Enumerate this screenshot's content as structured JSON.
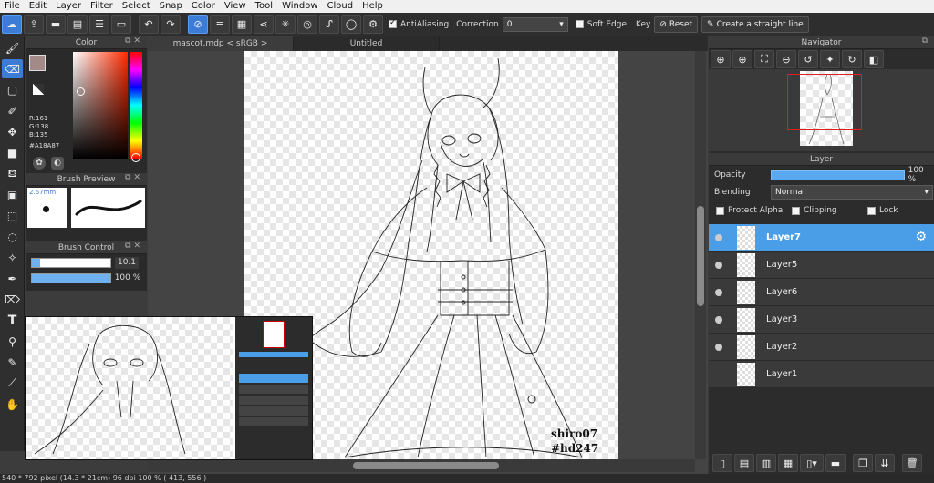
{
  "menu": [
    "File",
    "Edit",
    "Layer",
    "Filter",
    "Select",
    "Snap",
    "Color",
    "View",
    "Tool",
    "Window",
    "Cloud",
    "Help"
  ],
  "toolbar": {
    "antialiasing_label": "AntiAliasing",
    "correction_label": "Correction",
    "correction_value": "0",
    "soft_edge_label": "Soft Edge",
    "key_label": "Key",
    "reset_label": "Reset",
    "straight_line_label": "Create a straight line"
  },
  "color_panel": {
    "title": "Color",
    "r": "R:161",
    "g": "G:138",
    "b": "B:135",
    "hex": "#A18A87",
    "current_color": "#A18A87"
  },
  "brush_preview": {
    "title": "Brush Preview",
    "size": "2.67mm"
  },
  "brush_control": {
    "title": "Brush Control",
    "size_value": "10.1",
    "opacity_value": "100 %",
    "size_fraction": 0.1,
    "opacity_fraction": 1.0
  },
  "documents": {
    "tab1": "mascot.mdp < sRGB >",
    "tab2": "Untitled"
  },
  "watermark": {
    "line1": "shiro07",
    "line2": "#hd247"
  },
  "navigator": {
    "title": "Navigator"
  },
  "layer_panel": {
    "title": "Layer",
    "opacity_label": "Opacity",
    "opacity_value": "100 %",
    "blending_label": "Blending",
    "blending_value": "Normal",
    "protect_alpha": "Protect Alpha",
    "clipping": "Clipping",
    "lock": "Lock",
    "layers": [
      "Layer7",
      "Layer5",
      "Layer6",
      "Layer3",
      "Layer2",
      "Layer1"
    ]
  },
  "status": "540 * 792 pixel   (14.3 * 21cm)   96 dpi   100 %   ( 413, 556 )"
}
